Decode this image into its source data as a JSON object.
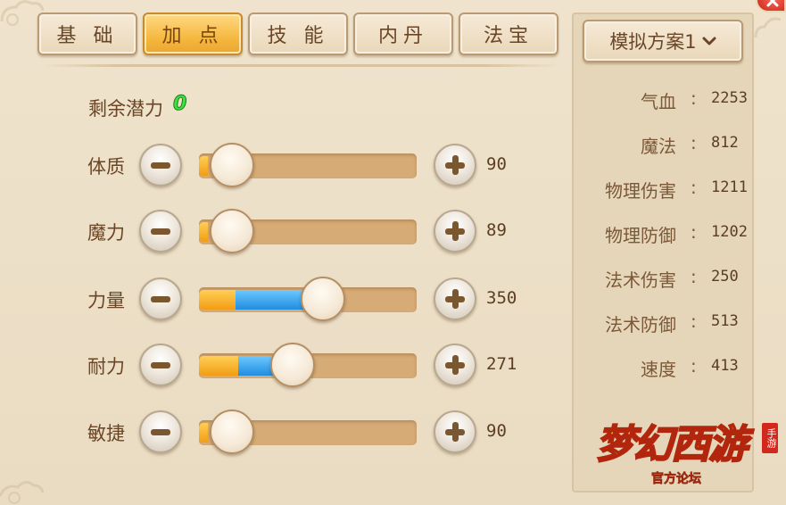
{
  "tabs": [
    {
      "label": "基 础",
      "active": false
    },
    {
      "label": "加 点",
      "active": true
    },
    {
      "label": "技 能",
      "active": false
    },
    {
      "label": "内丹",
      "active": false
    },
    {
      "label": "法宝",
      "active": false
    }
  ],
  "potential": {
    "label": "剩余潜力",
    "value": "0"
  },
  "stats": [
    {
      "label": "体质",
      "value": "90",
      "base_fraction": 0.04,
      "extra_fraction": 0.0,
      "knob_fraction": 0.15
    },
    {
      "label": "魔力",
      "value": "89",
      "base_fraction": 0.04,
      "extra_fraction": 0.0,
      "knob_fraction": 0.15
    },
    {
      "label": "力量",
      "value": "350",
      "base_fraction": 0.17,
      "extra_fraction": 0.4,
      "knob_fraction": 0.57
    },
    {
      "label": "耐力",
      "value": "271",
      "base_fraction": 0.18,
      "extra_fraction": 0.19,
      "knob_fraction": 0.43
    },
    {
      "label": "敏捷",
      "value": "90",
      "base_fraction": 0.04,
      "extra_fraction": 0.0,
      "knob_fraction": 0.15
    }
  ],
  "plan": {
    "label": "模拟方案1",
    "icon": "chevron-down-icon"
  },
  "attributes": [
    {
      "name": "气血",
      "value": "2253"
    },
    {
      "name": "魔法",
      "value": "812"
    },
    {
      "name": "物理伤害",
      "value": "1211"
    },
    {
      "name": "物理防御",
      "value": "1202"
    },
    {
      "name": "法术伤害",
      "value": "250"
    },
    {
      "name": "法术防御",
      "value": "513"
    },
    {
      "name": "速度",
      "value": "413"
    }
  ],
  "attr_separator": ":",
  "logo": {
    "title": "梦幻西游",
    "subtitle": "官方论坛",
    "tag": "手游"
  },
  "colors": {
    "accent_orange": "#f29d14",
    "accent_blue": "#1f8de0",
    "text_brown": "#6a4526",
    "potential_green": "#3ee23e"
  }
}
